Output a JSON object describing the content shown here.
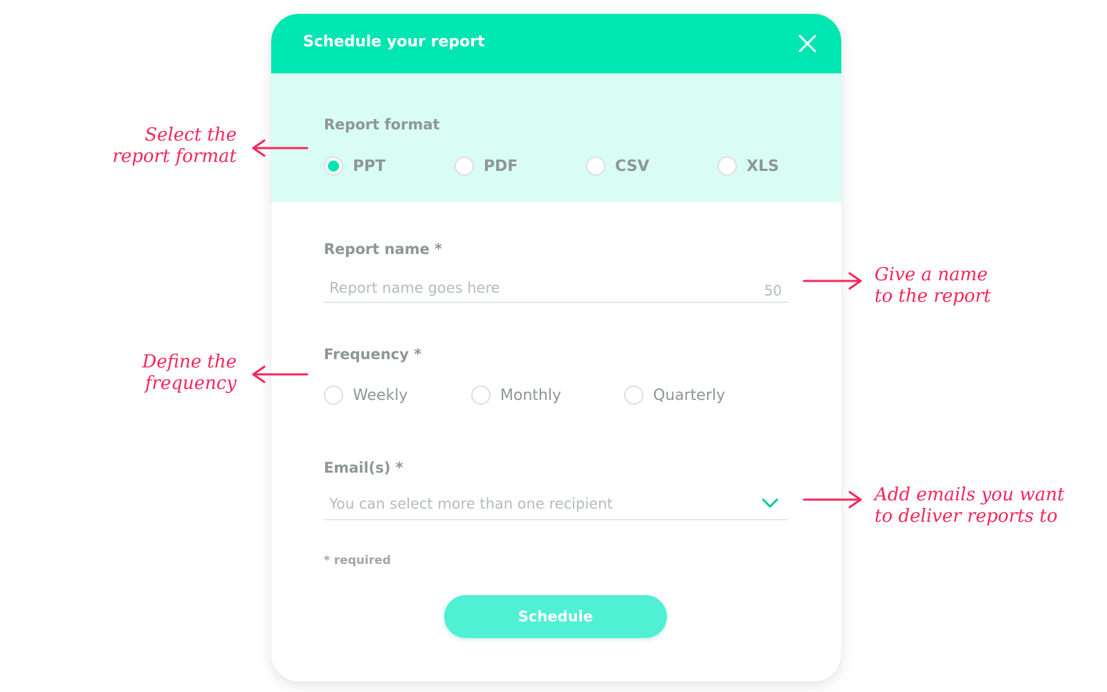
{
  "modal": {
    "title": "Schedule your report",
    "close_icon": "close-icon",
    "header_color": "#00e6b3",
    "panel_color": "#d9fdf5"
  },
  "report_format": {
    "label": "Report format",
    "options": [
      "PPT",
      "PDF",
      "CSV",
      "XLS"
    ],
    "selected": "PPT"
  },
  "report_name": {
    "label": "Report name *",
    "placeholder": "Report name goes here",
    "counter": "50"
  },
  "frequency": {
    "label": "Frequency *",
    "options": [
      "Weekly",
      "Monthly",
      "Quarterly"
    ],
    "selected": null
  },
  "emails": {
    "label": "Email(s) *",
    "placeholder": "You can select more than one recipient",
    "dropdown_icon": "chevron-down-icon"
  },
  "required_note": "* required",
  "schedule_button": "Schedule",
  "annotations": {
    "format_line1": "Select the",
    "format_line2": "report format",
    "name_line1": "Give a name",
    "name_line2": "to the report",
    "frequency_line1": "Define the",
    "frequency_line2": "frequency",
    "emails_line1": "Add emails you want",
    "emails_line2": "to deliver reports to",
    "color": "#f2285a"
  }
}
